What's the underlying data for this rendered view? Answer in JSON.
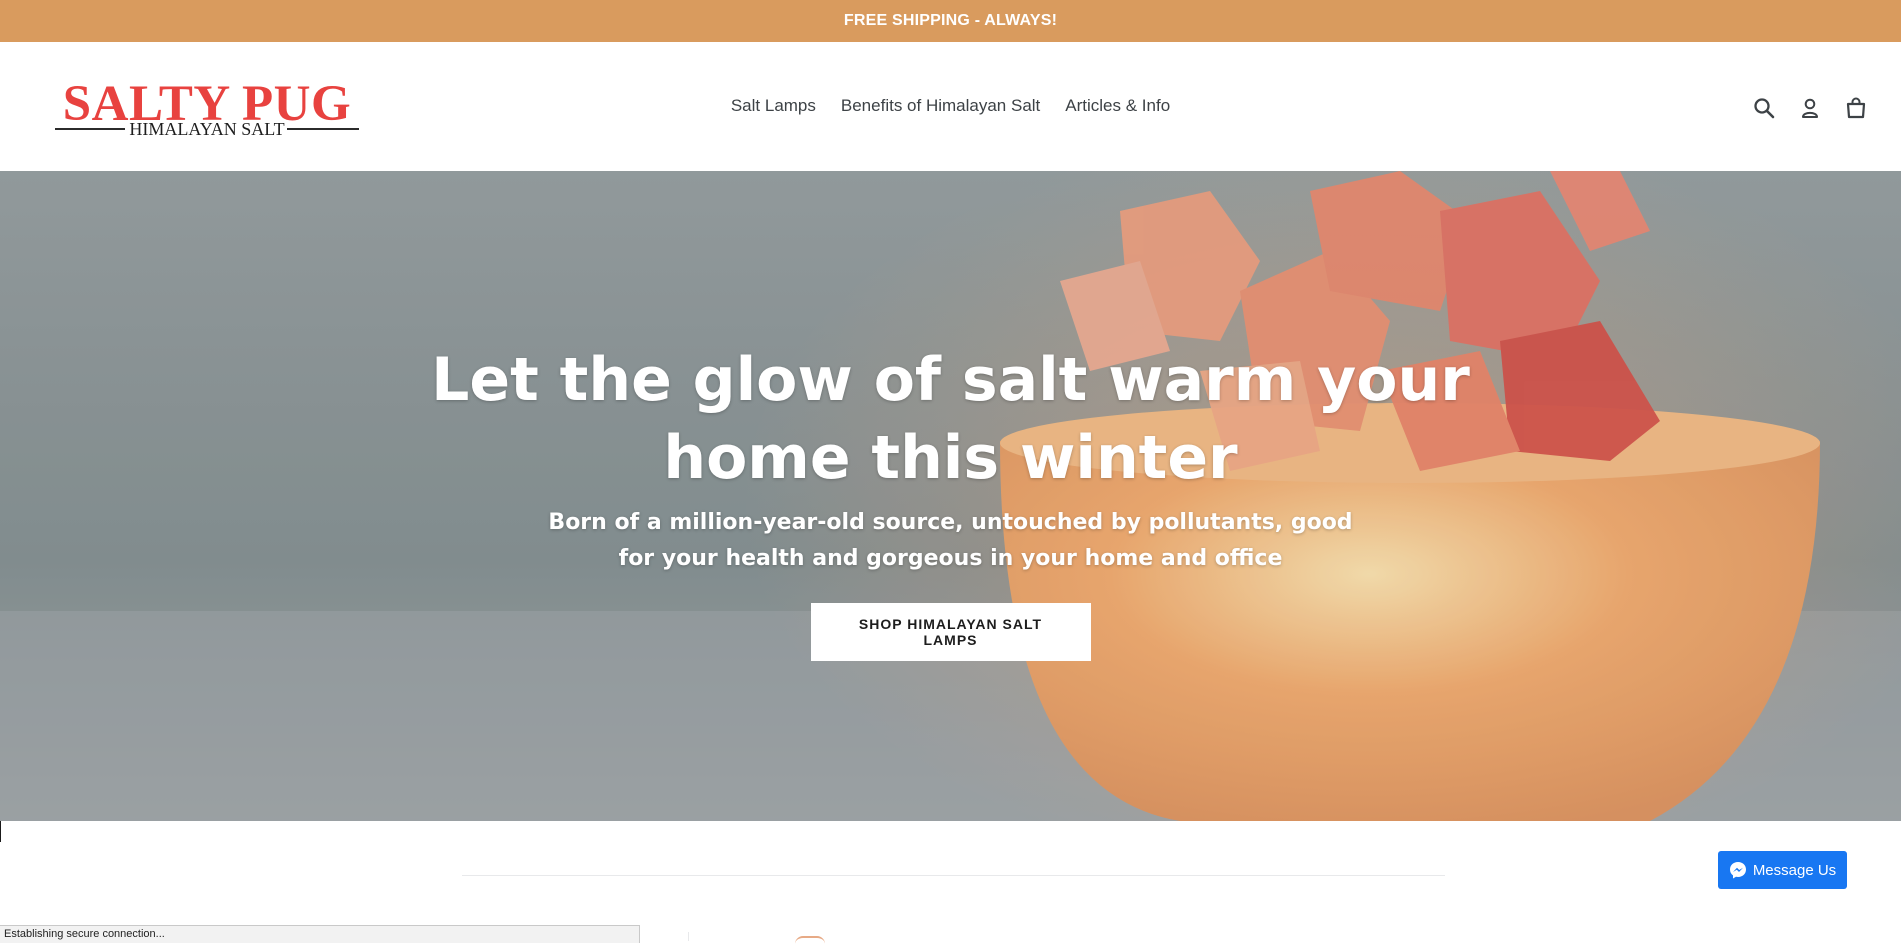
{
  "announcement": {
    "text": "FREE SHIPPING - ALWAYS!",
    "background": "#d99b5e"
  },
  "header": {
    "logo": {
      "title": "SALTY PUG",
      "subtitle": "HIMALAYAN SALT",
      "color": "#e8423f"
    },
    "nav": [
      {
        "label": "Salt Lamps"
      },
      {
        "label": "Benefits of Himalayan Salt"
      },
      {
        "label": "Articles & Info"
      }
    ],
    "icons": [
      "search-icon",
      "account-icon",
      "cart-icon"
    ]
  },
  "hero": {
    "title": "Let the glow of salt warm your home this winter",
    "subtitle": "Born of a million-year-old source, untouched by pollutants, good for your health and gorgeous in your home and office",
    "button": "SHOP HIMALAYAN SALT LAMPS"
  },
  "messenger": {
    "label": "Message Us",
    "color": "#1877f2"
  },
  "status_bar": {
    "text": "Establishing secure connection..."
  }
}
